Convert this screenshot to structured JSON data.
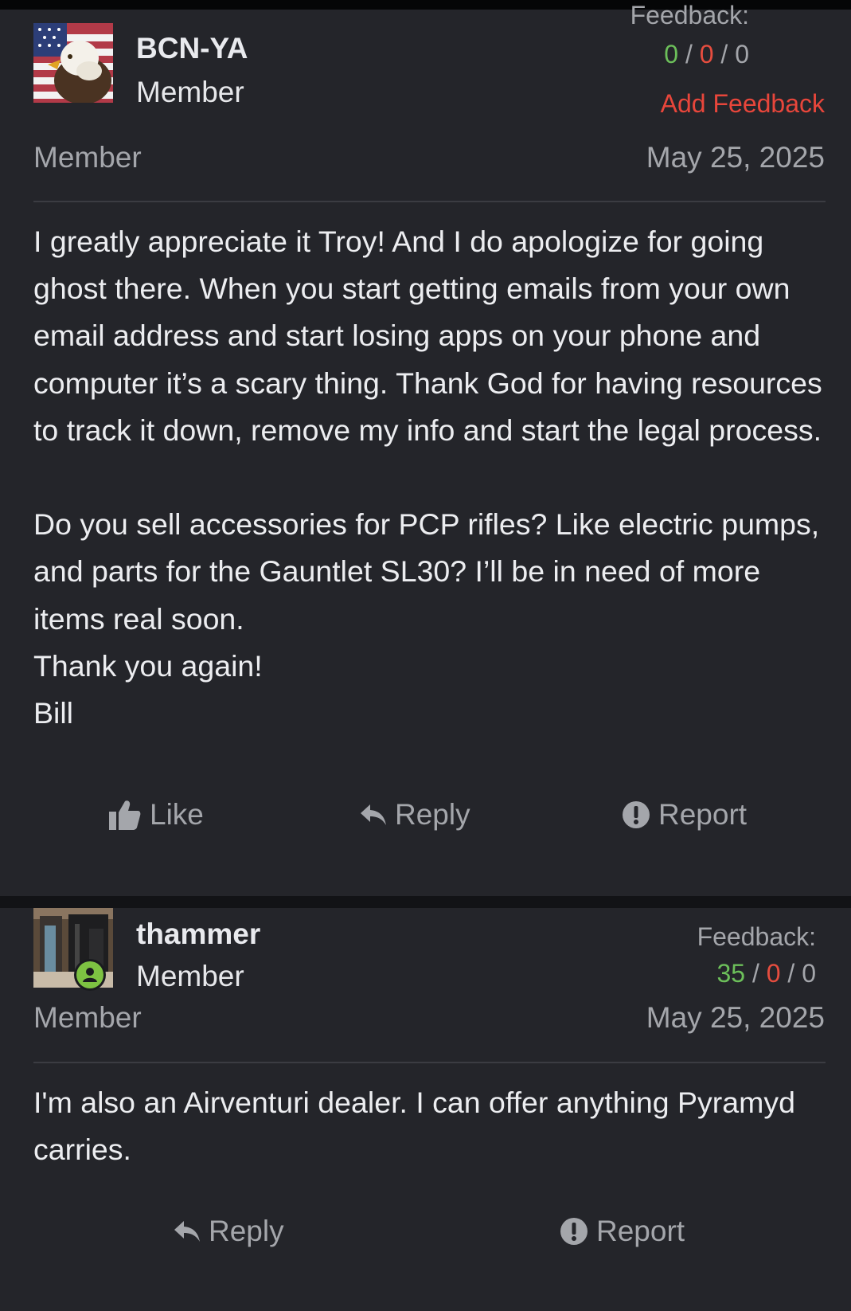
{
  "posts": [
    {
      "author": {
        "name": "BCN-YA",
        "title": "Member",
        "avatar_icon": "eagle-flag-avatar"
      },
      "role": "Member",
      "date": "May 25, 2025",
      "feedback": {
        "label": "Feedback:",
        "positive": "0",
        "negative": "0",
        "neutral": "0",
        "separator": "/"
      },
      "add_feedback_label": "Add Feedback",
      "body": "I greatly appreciate it Troy! And I do apologize for going ghost there. When you start getting emails from your own email address and start losing apps on your phone and computer it’s a scary thing. Thank God for having resources to track it down, remove my info and start the legal process.\n\nDo you sell accessories for PCP rifles? Like electric pumps, and parts for the Gauntlet SL30? I’ll be in need of more items real soon.\nThank you again!\nBill",
      "actions": {
        "like": "Like",
        "reply": "Reply",
        "report": "Report"
      }
    },
    {
      "author": {
        "name": "thammer",
        "title": "Member",
        "avatar_icon": "dealer-photo-avatar",
        "online_icon": "online-status-icon"
      },
      "role": "Member",
      "date": "May 25, 2025",
      "feedback": {
        "label": "Feedback:",
        "positive": "35",
        "negative": "0",
        "neutral": "0",
        "separator": "/"
      },
      "body": "I'm also an Airventuri dealer. I can offer anything Pyramyd carries.",
      "actions": {
        "reply": "Reply",
        "report": "Report"
      }
    }
  ],
  "colors": {
    "background": "#24252a",
    "positive": "#6cbf5a",
    "negative": "#e64d3f",
    "add_feedback": "#e8463b",
    "muted": "#a4a6ab",
    "online": "#7dc242"
  }
}
